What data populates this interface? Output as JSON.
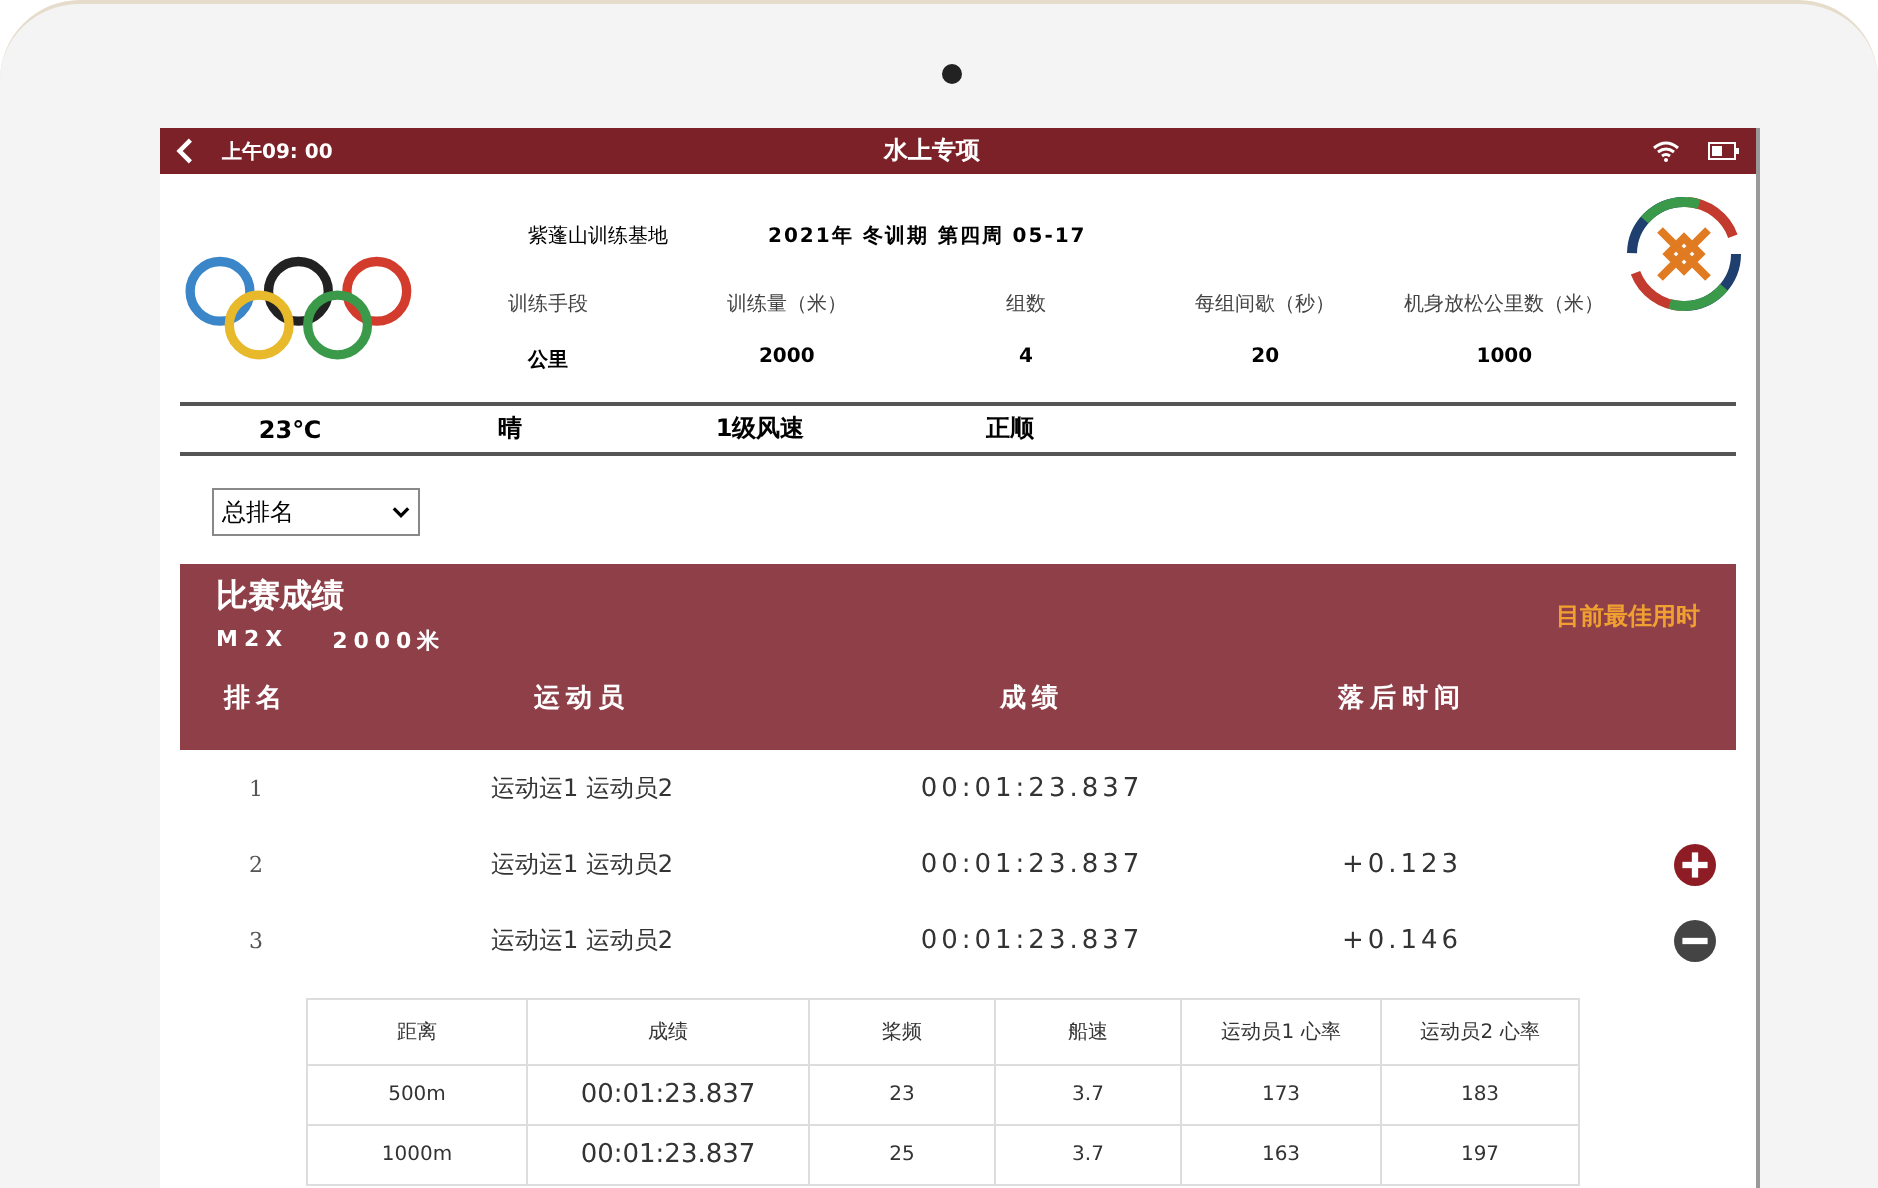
{
  "status_bar": {
    "time": "上午09: 00",
    "title": "水上专项"
  },
  "header": {
    "base": "紫蓬山训练基地",
    "period": "2021年 冬训期 第四周 05-17",
    "stats": [
      {
        "label": "训练手段",
        "value": "公里"
      },
      {
        "label": "训练量（米）",
        "value": "2000"
      },
      {
        "label": "组数",
        "value": "4"
      },
      {
        "label": "每组间歇（秒）",
        "value": "20"
      },
      {
        "label": "机身放松公里数（米）",
        "value": "1000"
      }
    ]
  },
  "weather": [
    "23℃",
    "晴",
    "1级风速",
    "正顺"
  ],
  "ranking_select": {
    "value": "总排名"
  },
  "results": {
    "title": "比赛成绩",
    "boat": "M2X",
    "distance": "2000米",
    "best_time_label": "目前最佳用时",
    "columns": [
      "排名",
      "运动员",
      "成绩",
      "落后时间"
    ],
    "rows": [
      {
        "rank": "1",
        "athletes": "运动运1 运动员2",
        "time": "00:01:23.837"
      },
      {
        "rank": "2",
        "athletes": "运动运1 运动员2",
        "time": "00:01:23.837",
        "gap": "+0.123",
        "expanded": false
      },
      {
        "rank": "3",
        "athletes": "运动运1 运动员2",
        "time": "00:01:23.837",
        "gap": "+0.146",
        "expanded": true,
        "splits": {
          "columns": [
            "距离",
            "成绩",
            "桨频",
            "船速",
            "运动员1 心率",
            "运动员2 心率"
          ],
          "rows": [
            [
              "500m",
              "00:01:23.837",
              "23",
              "3.7",
              "173",
              "183"
            ],
            [
              "1000m",
              "00:01:23.837",
              "25",
              "3.7",
              "163",
              "197"
            ]
          ]
        }
      }
    ]
  }
}
